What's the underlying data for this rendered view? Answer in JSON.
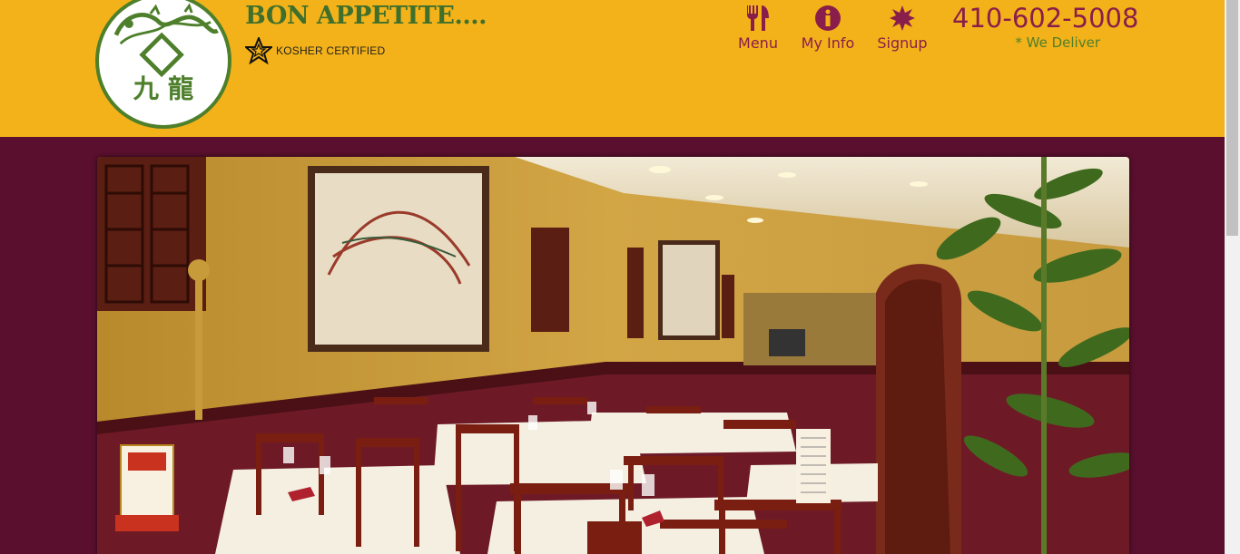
{
  "header": {
    "tagline": "BON APPETITE....",
    "kosher": "KOSHER CERTIFIED",
    "phone": "410-602-5008",
    "deliver": "* We Deliver",
    "logo_chars": "九 龍"
  },
  "nav": [
    {
      "label": "Menu",
      "icon": "fork-knife-icon"
    },
    {
      "label": "My Info",
      "icon": "info-icon"
    },
    {
      "label": "Signup",
      "icon": "starburst-icon"
    }
  ],
  "hero": {
    "alt": "restaurant-dining-room-photo"
  },
  "colors": {
    "header_bg": "#f3b219",
    "page_bg": "#5a0f2e",
    "accent_maroon": "#8a1e4a",
    "accent_green": "#4e7f2b"
  }
}
